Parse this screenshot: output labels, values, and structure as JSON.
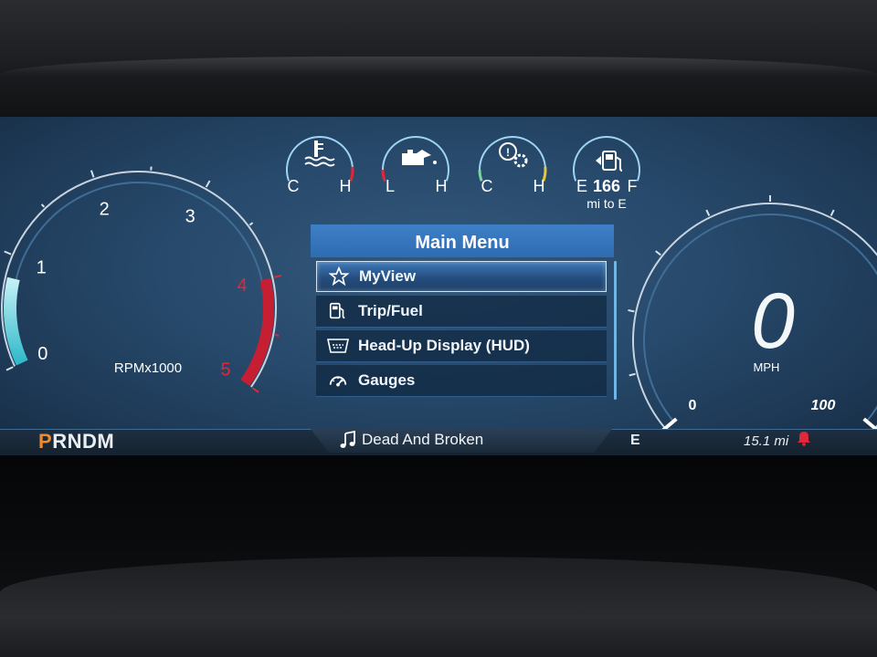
{
  "tachometer": {
    "unit_label": "RPMx1000",
    "ticks": [
      "0",
      "1",
      "2",
      "3",
      "4",
      "5"
    ],
    "rpm_value": 0.8,
    "redline_from": 4
  },
  "speedometer": {
    "speed": "0",
    "unit": "MPH",
    "min_label": "0",
    "max_label": "100"
  },
  "mini_gauges": [
    {
      "name": "coolant-temp",
      "icon": "coolant-temp-icon",
      "low": "C",
      "high": "H",
      "level": 0.45
    },
    {
      "name": "oil-pressure",
      "icon": "oil-can-icon",
      "low": "L",
      "high": "H",
      "level": 0.55
    },
    {
      "name": "transmission-temp",
      "icon": "transmission-gear-icon",
      "low": "C",
      "high": "H",
      "level": 0.4
    },
    {
      "name": "fuel",
      "icon": "fuel-pump-icon",
      "low": "E",
      "high": "F",
      "level": 0.55,
      "range_value": "166",
      "range_label": "mi to E"
    }
  ],
  "menu": {
    "title": "Main Menu",
    "items": [
      {
        "label": "MyView",
        "icon": "star-icon",
        "selected": true
      },
      {
        "label": "Trip/Fuel",
        "icon": "fuel-pump-icon",
        "selected": false
      },
      {
        "label": "Head-Up Display (HUD)",
        "icon": "hud-windshield-icon",
        "selected": false
      },
      {
        "label": "Gauges",
        "icon": "gauge-icon",
        "selected": false
      }
    ]
  },
  "status_bar": {
    "gear_active": "P",
    "gear_rest": "RNDM",
    "media_icon": "music-note-icon",
    "media_title": "Dead And Broken",
    "compass": "E",
    "trip_distance": "15.1 mi",
    "alert_icon": "bell-alert-icon"
  },
  "colors": {
    "accent_blue": "#3e7fc6",
    "redline": "#e0283a",
    "gear_active": "#f08a2a",
    "needle_fill": "#4fd2de",
    "alert": "#e0283a"
  }
}
